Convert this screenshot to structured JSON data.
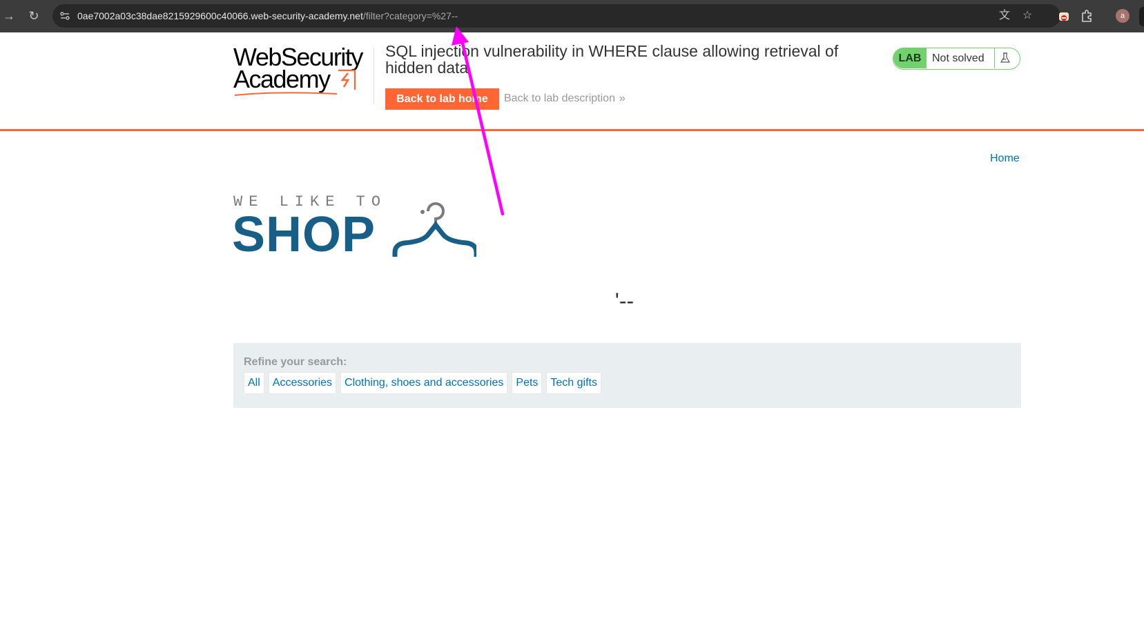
{
  "browser": {
    "url_host": "0ae7002a03c38dae8215929600c40066.web-security-academy.net",
    "url_path": "/filter?category=%27--",
    "profile_initial": "a",
    "icons": [
      "forward-icon",
      "reload-icon",
      "site-info-icon",
      "translate-icon",
      "star-icon",
      "extension-icon",
      "puzzle-icon",
      "profile-avatar"
    ]
  },
  "lab_header": {
    "logo_line1": "WebSecurity",
    "logo_line2": "Academy",
    "title": "SQL injection vulnerability in WHERE clause allowing retrieval of hidden data",
    "back_home_label": "Back to lab home",
    "back_description_label": "Back to lab description",
    "lab_badge": "LAB",
    "lab_status": "Not solved",
    "colors": {
      "accent": "#ff6633",
      "lab_green": "#70d16d"
    }
  },
  "page": {
    "home_link": "Home",
    "shop_tagline": "WE LIKE TO",
    "shop_word": "SHOP",
    "filter_title": "'--",
    "refine_label": "Refine your search:",
    "categories": [
      "All",
      "Accessories",
      "Clothing, shoes and accessories",
      "Pets",
      "Tech gifts"
    ],
    "colors": {
      "shop_blue": "#185f88",
      "link_blue": "#0071bc",
      "annotation_arrow": "#ff00ff"
    }
  }
}
